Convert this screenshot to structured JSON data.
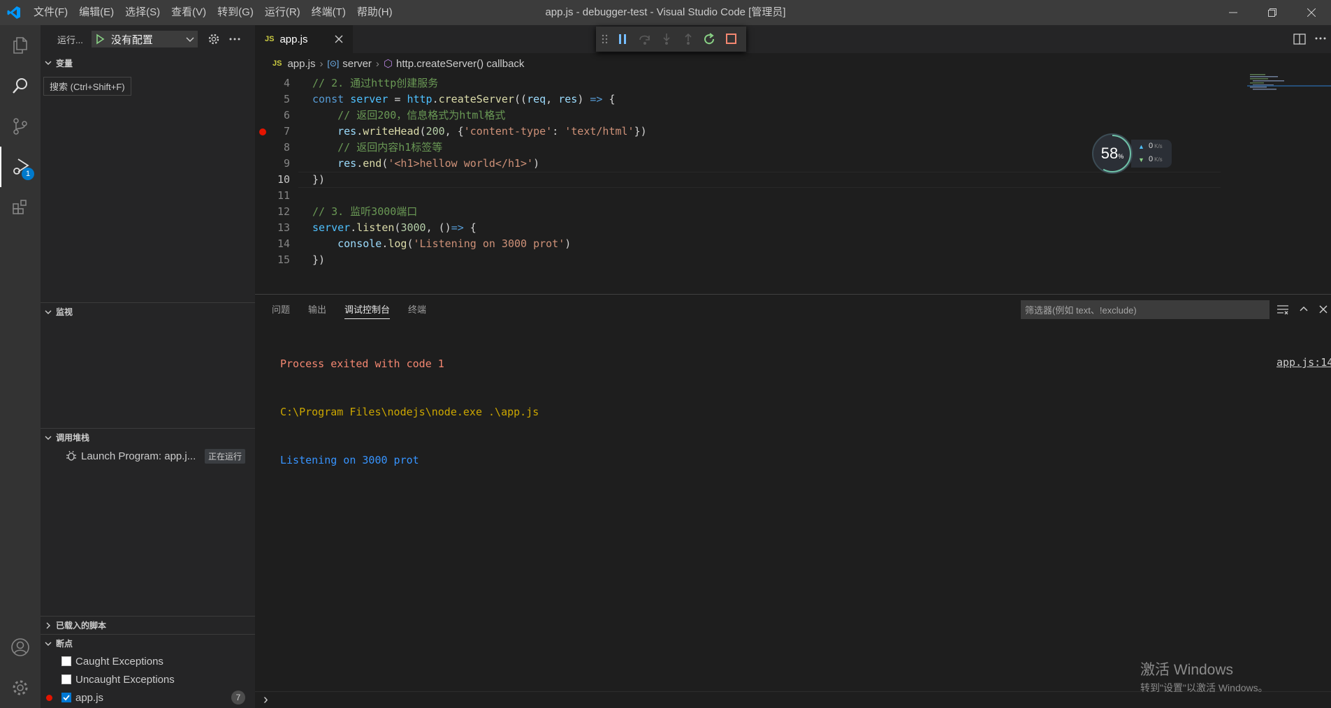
{
  "window": {
    "title": "app.js - debugger-test - Visual Studio Code [管理员]",
    "menus": [
      "文件(F)",
      "编辑(E)",
      "选择(S)",
      "查看(V)",
      "转到(G)",
      "运行(R)",
      "终端(T)",
      "帮助(H)"
    ]
  },
  "activity": {
    "tooltip": "搜索 (Ctrl+Shift+F)",
    "debug_badge": "1"
  },
  "sidebar": {
    "run_label": "运行...",
    "config_label": "没有配置",
    "sections": {
      "variables": "变量",
      "watch": "监视",
      "callstack": "调用堆栈",
      "loaded_scripts": "已载入的脚本",
      "breakpoints": "断点"
    },
    "callstack_item": "Launch Program: app.j...",
    "callstack_status": "正在运行",
    "breakpoints": [
      {
        "label": "Caught Exceptions",
        "checked": false
      },
      {
        "label": "Uncaught Exceptions",
        "checked": false
      },
      {
        "label": "app.js",
        "checked": true,
        "count": "7"
      }
    ]
  },
  "editor": {
    "tab_label": "app.js",
    "tab_icon_text": "JS",
    "breadcrumb": [
      "app.js",
      "server",
      "http.createServer() callback"
    ],
    "current_line": 10,
    "breakpoint_line": 7,
    "lines": [
      {
        "n": "4",
        "text": "// 2. 通过http创建服务"
      },
      {
        "n": "5",
        "text": "const server = http.createServer((req, res) => {"
      },
      {
        "n": "6",
        "text": "    // 返回200，信息格式为html格式"
      },
      {
        "n": "7",
        "text": "    res.writeHead(200, {'content-type': 'text/html'})"
      },
      {
        "n": "8",
        "text": "    // 返回内容h1标签等"
      },
      {
        "n": "9",
        "text": "    res.end('<h1>hellow world</h1>')"
      },
      {
        "n": "10",
        "text": "})"
      },
      {
        "n": "11",
        "text": ""
      },
      {
        "n": "12",
        "text": "// 3. 监听3000端口"
      },
      {
        "n": "13",
        "text": "server.listen(3000, ()=> {"
      },
      {
        "n": "14",
        "text": "    console.log('Listening on 3000 prot')"
      },
      {
        "n": "15",
        "text": "})"
      }
    ]
  },
  "speed_widget": {
    "percent": "58",
    "percent_unit": "%",
    "up": "0",
    "down": "0",
    "unit": "K/s"
  },
  "panel": {
    "tabs": [
      "问题",
      "输出",
      "调试控制台",
      "终端"
    ],
    "active_tab": "调试控制台",
    "filter_placeholder": "筛选器(例如 text、!exclude)",
    "output": [
      {
        "text": "Process exited with code 1",
        "kind": "err"
      },
      {
        "text": "C:\\Program Files\\nodejs\\node.exe .\\app.js",
        "kind": "path"
      },
      {
        "text": "Listening on 3000 prot",
        "kind": "info"
      }
    ],
    "source_link": "app.js:14",
    "repl_prompt": "›"
  },
  "watermark": {
    "line1": "激活 Windows",
    "line2": "转到\"设置\"以激活 Windows。"
  }
}
